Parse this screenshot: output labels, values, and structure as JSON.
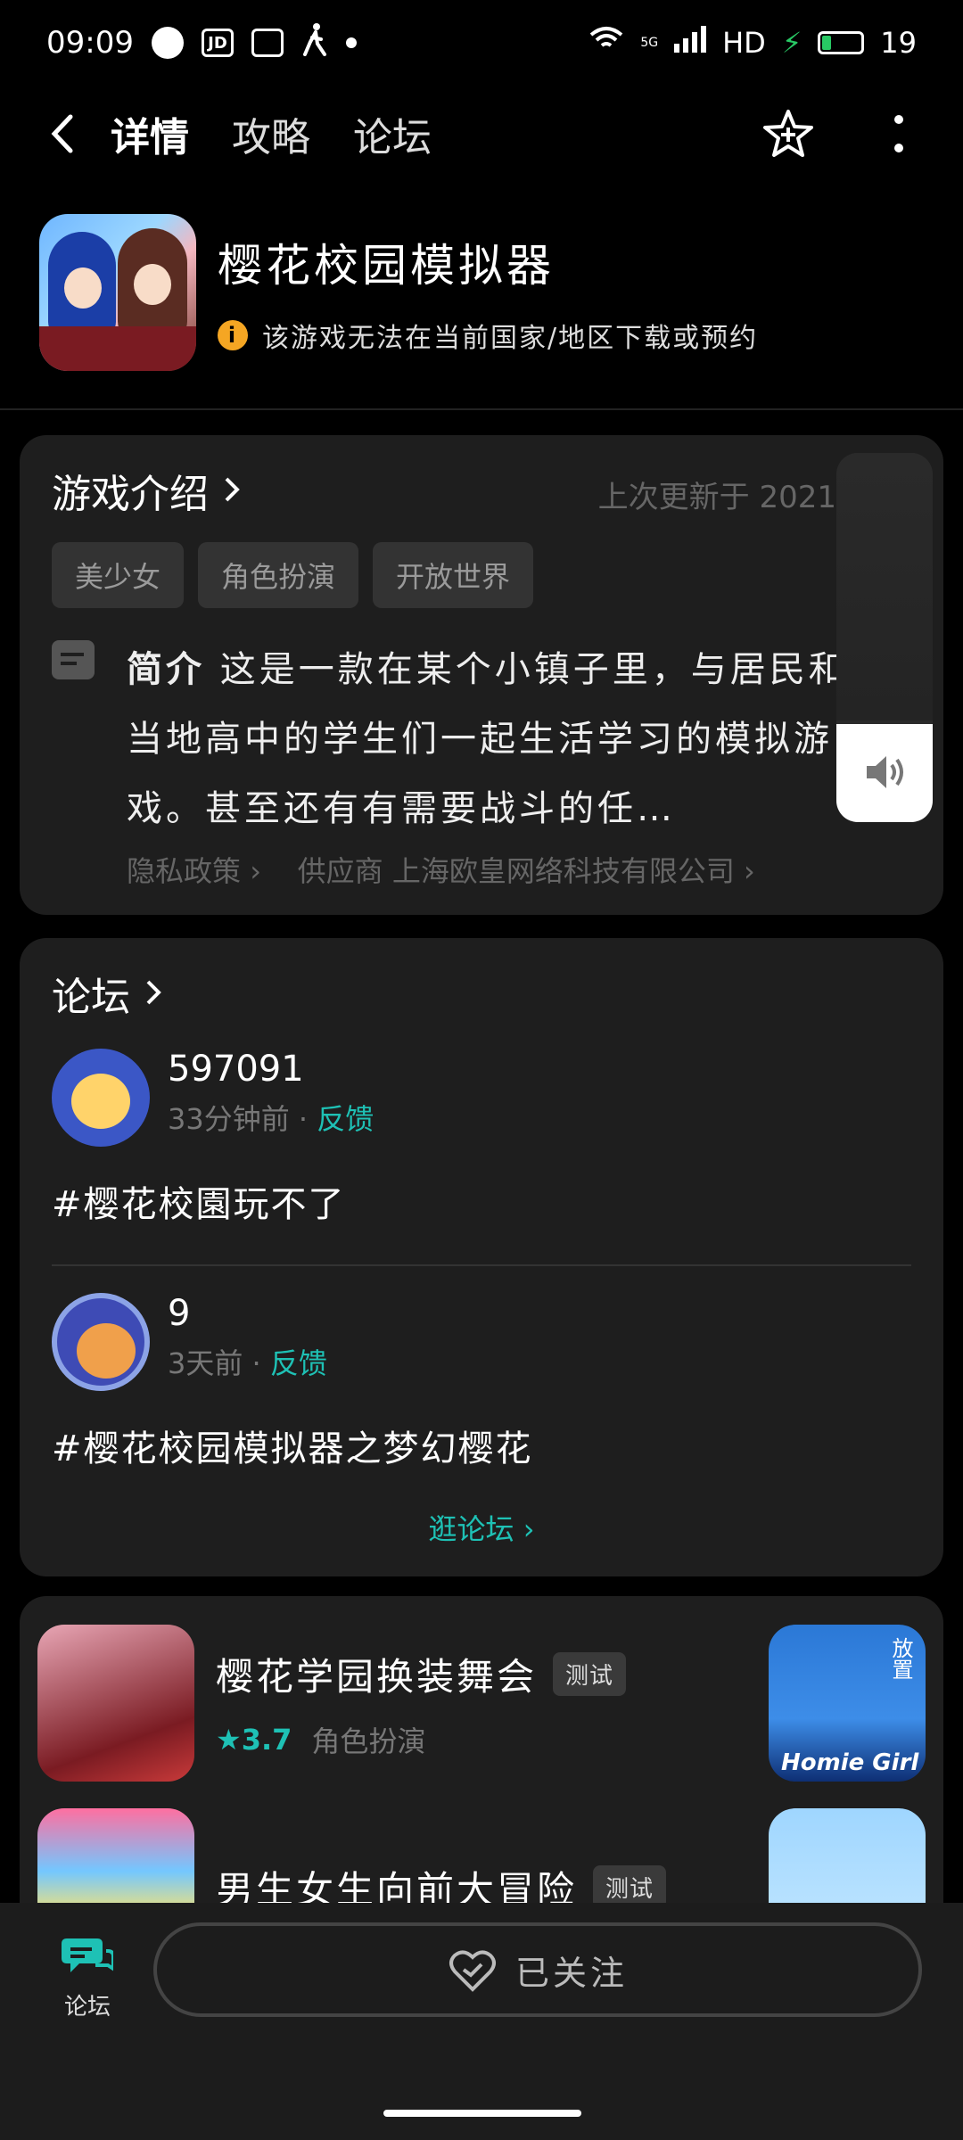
{
  "status_bar": {
    "time": "09:09",
    "network": "5G",
    "hd": "HD",
    "battery": "19"
  },
  "nav": {
    "tabs": [
      {
        "label": "详情"
      },
      {
        "label": "攻略"
      },
      {
        "label": "论坛"
      }
    ]
  },
  "app": {
    "title": "樱花校园模拟器",
    "notice": "该游戏无法在当前国家/地区下载或预约"
  },
  "intro": {
    "section_title": "游戏介绍",
    "updated": "上次更新于 2021",
    "tags": [
      "美少女",
      "角色扮演",
      "开放世界"
    ],
    "desc_label": "简介",
    "desc_text": "这是一款在某个小镇子里，与居民和当地高中的学生们一起生活学习的模拟游戏。甚至还有有需要战斗的任…",
    "privacy": "隐私政策",
    "supplier_label": "供应商",
    "supplier": "上海欧皇网络科技有限公司"
  },
  "forum": {
    "section_title": "论坛",
    "posts": [
      {
        "user": "597091",
        "time": "33分钟前",
        "category": "反馈",
        "text": "#樱花校園玩不了"
      },
      {
        "user": "9",
        "time": "3天前",
        "category": "反馈",
        "text": "#樱花校园模拟器之梦幻樱花"
      }
    ],
    "more": "逛论坛"
  },
  "related": [
    {
      "title": "樱花学园换装舞会",
      "badge": "测试",
      "rating": "3.7",
      "genre": "角色扮演",
      "right_text": "Homie Girl",
      "right_tag": "放置"
    },
    {
      "title": "男生女生向前大冒险",
      "badge": "测试"
    }
  ],
  "bottom": {
    "forum_tab": "论坛",
    "follow": "已关注"
  },
  "colors": {
    "accent": "#1ec1b5",
    "background": "#000000",
    "card": "#1e1e1e"
  }
}
